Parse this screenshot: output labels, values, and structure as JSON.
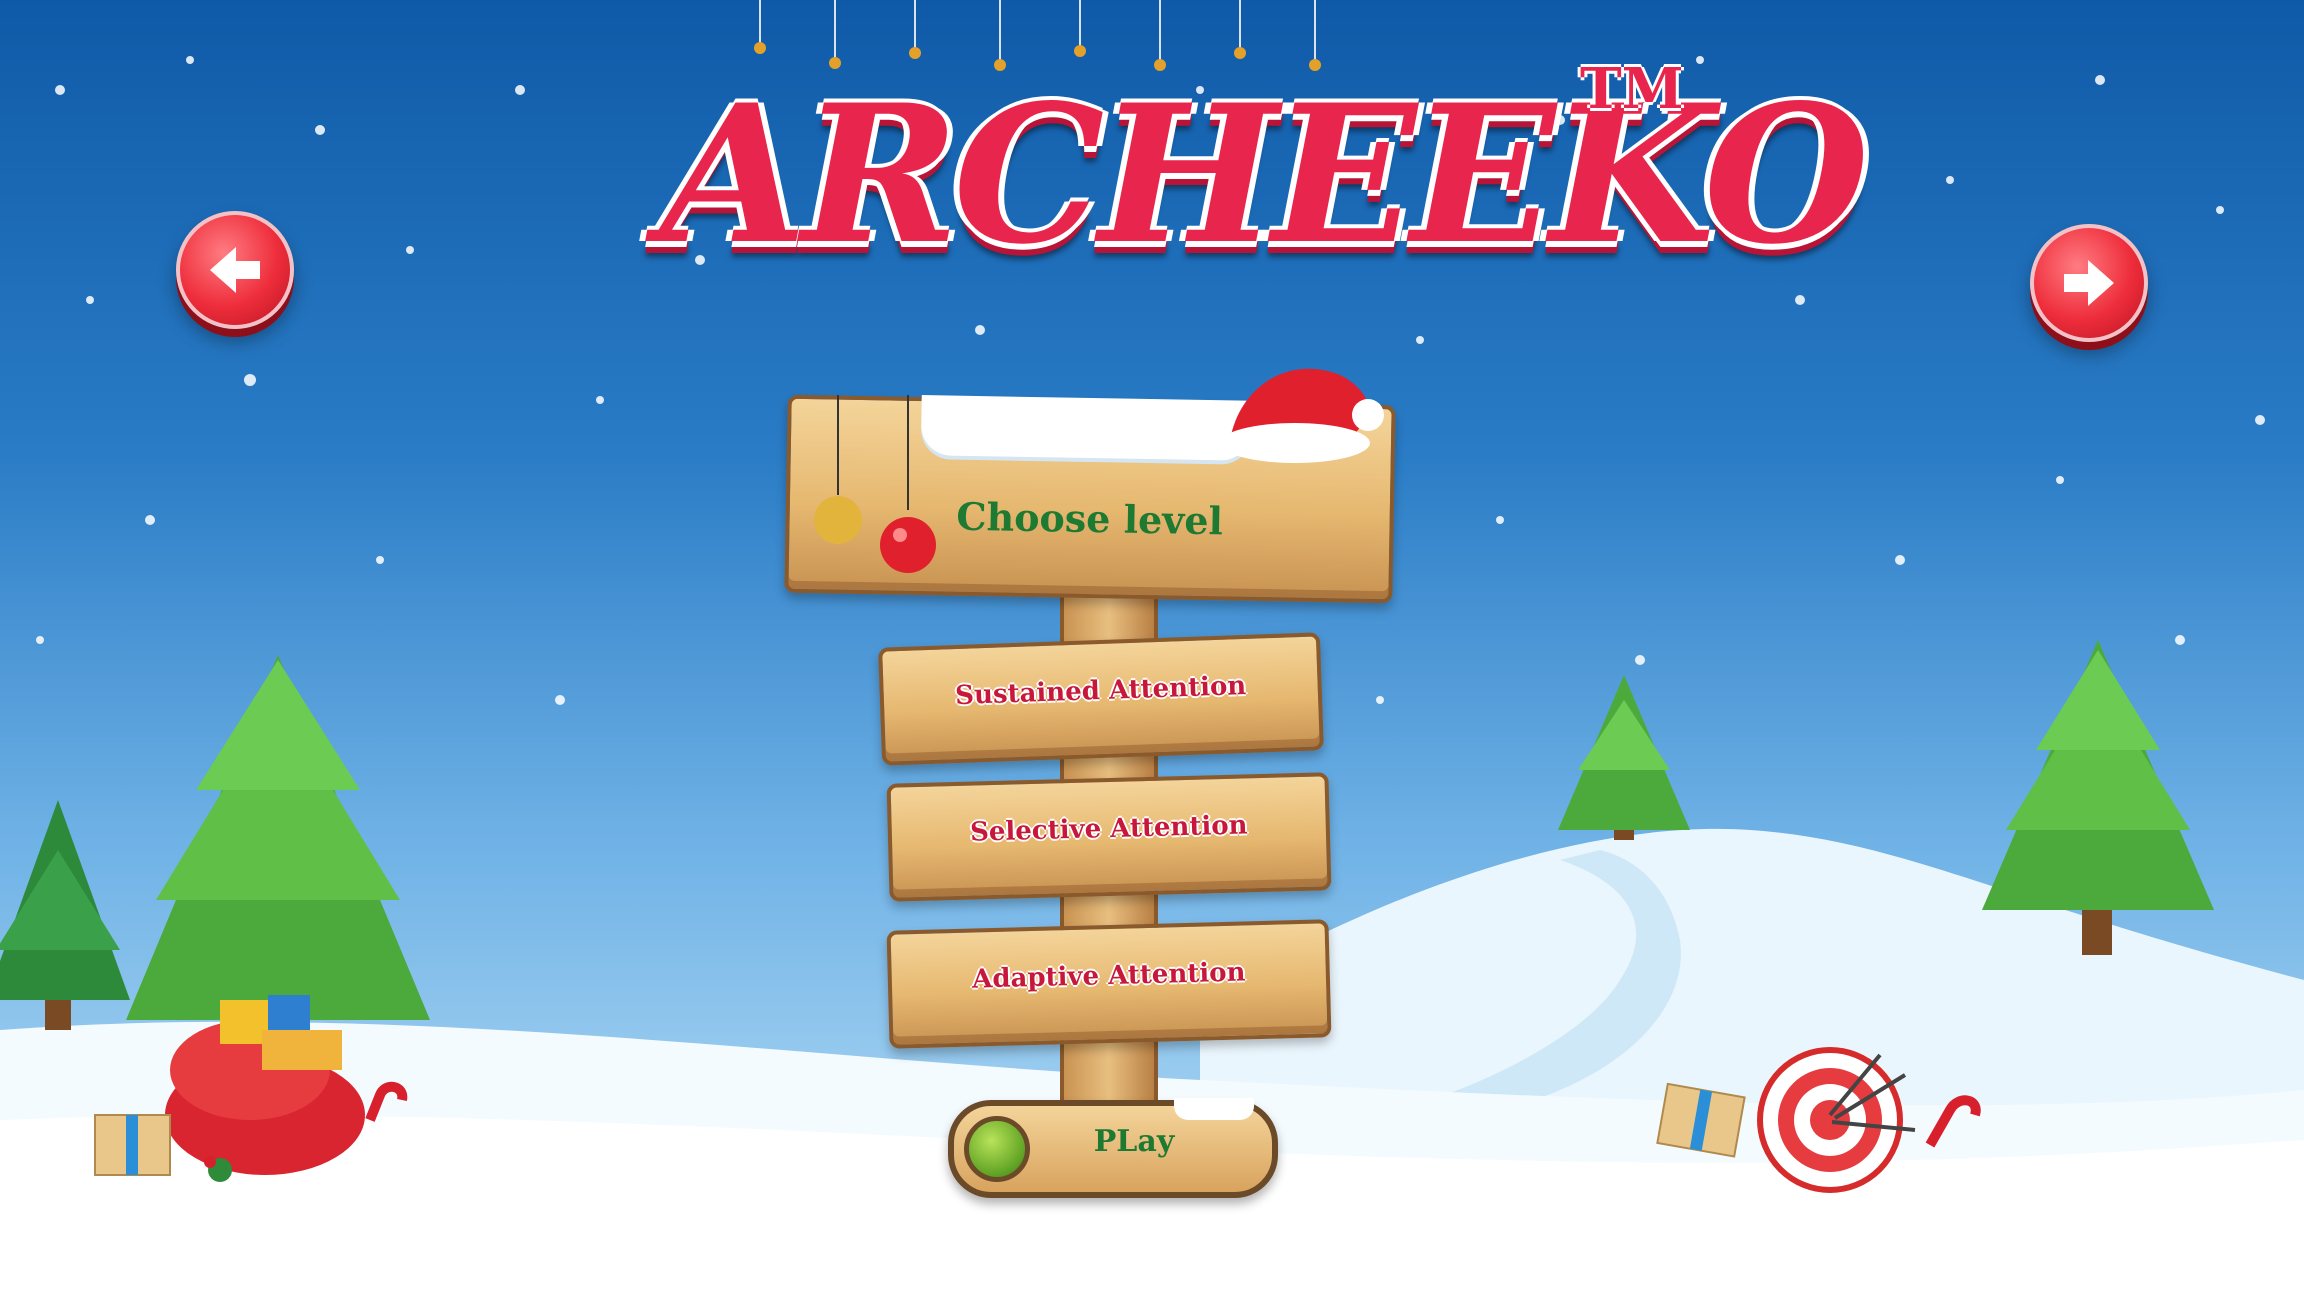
{
  "game": {
    "title": "ARCHEEKO",
    "trademark": "TM"
  },
  "nav": {
    "back_icon": "arrow-left-icon",
    "next_icon": "arrow-right-icon"
  },
  "menu": {
    "heading": "Choose level",
    "levels": [
      {
        "label": "Sustained Attention"
      },
      {
        "label": "Selective Attention"
      },
      {
        "label": "Adaptive Attention"
      }
    ],
    "play_label": "PLay"
  },
  "colors": {
    "title_red": "#e8254c",
    "heading_green": "#1e7a32",
    "option_red": "#c7183c",
    "wood": "#e6b870"
  }
}
